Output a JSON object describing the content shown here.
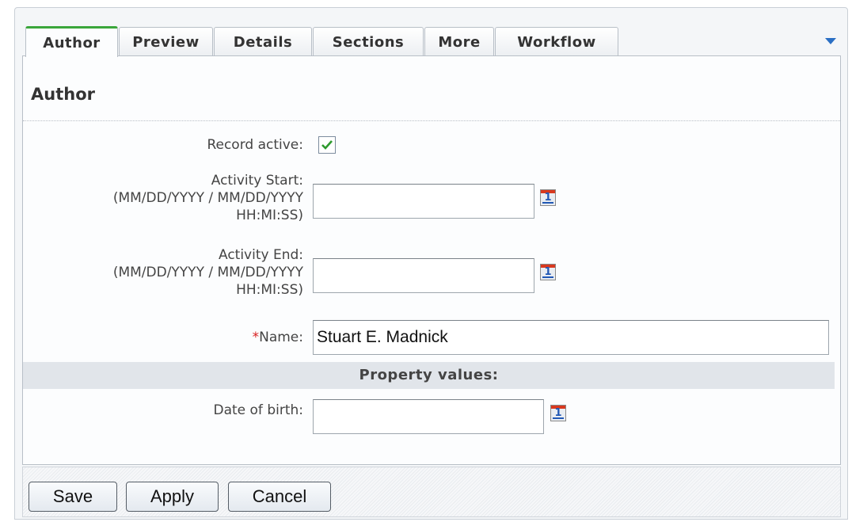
{
  "tabs": [
    {
      "label": "Author",
      "active": true
    },
    {
      "label": "Preview",
      "active": false
    },
    {
      "label": "Details",
      "active": false
    },
    {
      "label": "Sections",
      "active": false
    },
    {
      "label": "More",
      "active": false
    },
    {
      "label": "Workflow",
      "active": false
    }
  ],
  "page_title": "Author",
  "form": {
    "record_active_label": "Record active:",
    "record_active_checked": true,
    "activity_start_label": "Activity Start:",
    "activity_start_hint1": "(MM/DD/YYYY / MM/DD/YYYY",
    "activity_start_hint2": "HH:MI:SS)",
    "activity_start_value": "",
    "activity_end_label": "Activity End:",
    "activity_end_hint1": "(MM/DD/YYYY / MM/DD/YYYY",
    "activity_end_hint2": "HH:MI:SS)",
    "activity_end_value": "",
    "name_required_mark": "*",
    "name_label": "Name:",
    "name_value": "Stuart E. Madnick",
    "property_values_heading": "Property values:",
    "date_of_birth_label": "Date of birth:",
    "date_of_birth_value": "",
    "calendar_icon_text": "1"
  },
  "buttons": {
    "save": "Save",
    "apply": "Apply",
    "cancel": "Cancel"
  },
  "colors": {
    "active_tab_accent": "#3aa63a",
    "required_mark": "#d81f1f",
    "tab_menu_arrow": "#2a6fc4"
  }
}
